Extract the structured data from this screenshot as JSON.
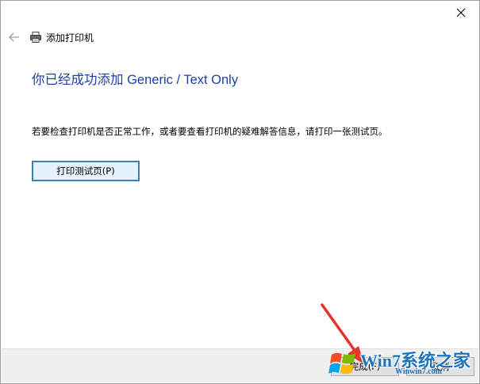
{
  "window": {
    "title": "添加打印机",
    "close_symbol": "✕"
  },
  "main": {
    "heading": "你已经成功添加 Generic / Text Only",
    "description": "若要检查打印机是否正常工作，或者要查看打印机的疑难解答信息，请打印一张测试页。",
    "test_page_button": "打印测试页(P)"
  },
  "footer": {
    "finish_button": "完成(F)",
    "cancel_button": "取消"
  },
  "watermark": {
    "brand": "Win7系统之家",
    "url": "Winwin7.com"
  },
  "colors": {
    "heading": "#1e3fa8",
    "annotation_arrow": "#e8332a",
    "focus_border": "#3c7fb1"
  },
  "icons": {
    "back": "back-arrow-icon",
    "printer": "printer-icon",
    "close": "close-icon"
  }
}
